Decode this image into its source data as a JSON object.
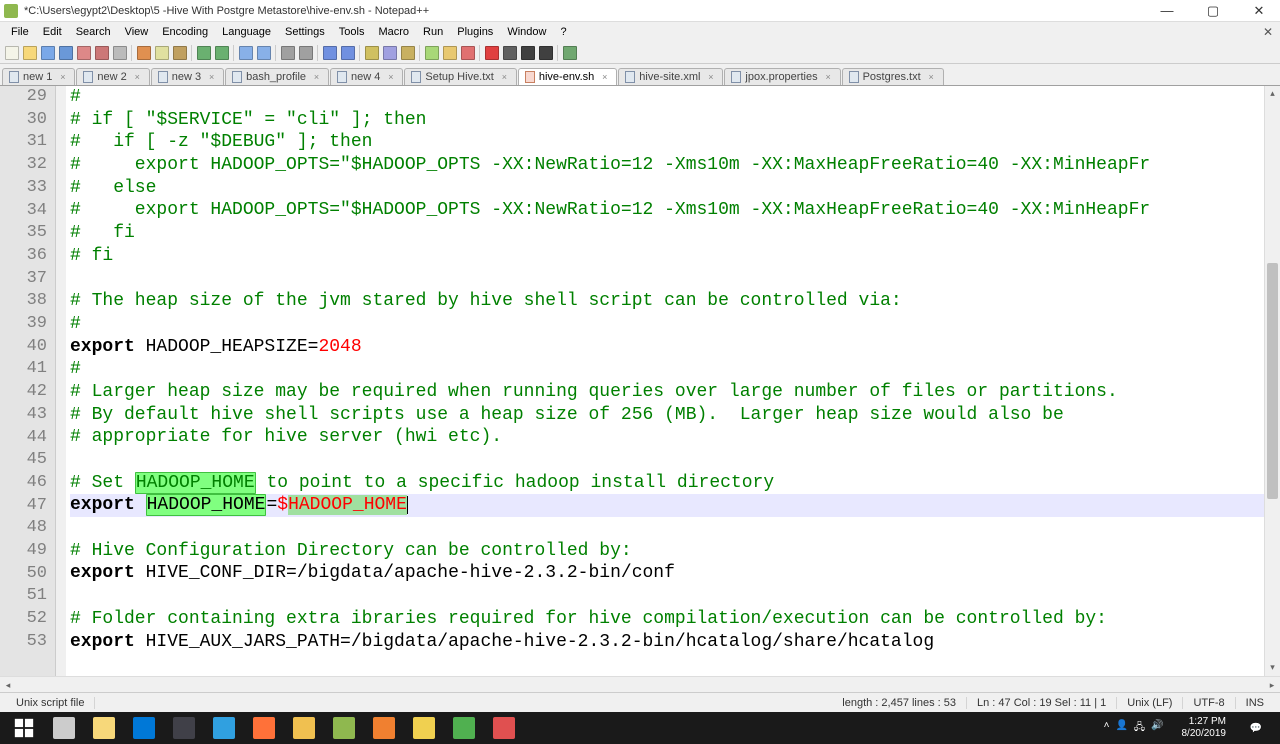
{
  "titlebar": {
    "title": "*C:\\Users\\egypt2\\Desktop\\5 -Hive With Postgre Metastore\\hive-env.sh - Notepad++"
  },
  "menubar": {
    "items": [
      "File",
      "Edit",
      "Search",
      "View",
      "Encoding",
      "Language",
      "Settings",
      "Tools",
      "Macro",
      "Run",
      "Plugins",
      "Window",
      "?"
    ]
  },
  "tabs": [
    {
      "label": "new 1",
      "dirty": false,
      "active": false
    },
    {
      "label": "new 2",
      "dirty": false,
      "active": false
    },
    {
      "label": "new 3",
      "dirty": false,
      "active": false
    },
    {
      "label": "bash_profile",
      "dirty": false,
      "active": false
    },
    {
      "label": "new 4",
      "dirty": false,
      "active": false
    },
    {
      "label": "Setup Hive.txt",
      "dirty": false,
      "active": false
    },
    {
      "label": "hive-env.sh",
      "dirty": true,
      "active": true
    },
    {
      "label": "hive-site.xml",
      "dirty": false,
      "active": false
    },
    {
      "label": "jpox.properties",
      "dirty": false,
      "active": false
    },
    {
      "label": "Postgres.txt",
      "dirty": false,
      "active": false
    }
  ],
  "editor": {
    "first_line": 29,
    "lines": [
      {
        "n": 29,
        "segs": [
          {
            "t": "#",
            "c": "comment"
          }
        ]
      },
      {
        "n": 30,
        "segs": [
          {
            "t": "# if [ \"$SERVICE\" = \"cli\" ]; then",
            "c": "comment"
          }
        ]
      },
      {
        "n": 31,
        "segs": [
          {
            "t": "#   if [ -z \"$DEBUG\" ]; then",
            "c": "comment"
          }
        ]
      },
      {
        "n": 32,
        "segs": [
          {
            "t": "#     export HADOOP_OPTS=\"$HADOOP_OPTS -XX:NewRatio=12 -Xms10m -XX:MaxHeapFreeRatio=40 -XX:MinHeapFr",
            "c": "comment"
          }
        ]
      },
      {
        "n": 33,
        "segs": [
          {
            "t": "#   else",
            "c": "comment"
          }
        ]
      },
      {
        "n": 34,
        "segs": [
          {
            "t": "#     export HADOOP_OPTS=\"$HADOOP_OPTS -XX:NewRatio=12 -Xms10m -XX:MaxHeapFreeRatio=40 -XX:MinHeapFr",
            "c": "comment"
          }
        ]
      },
      {
        "n": 35,
        "segs": [
          {
            "t": "#   fi",
            "c": "comment"
          }
        ]
      },
      {
        "n": 36,
        "segs": [
          {
            "t": "# fi",
            "c": "comment"
          }
        ]
      },
      {
        "n": 37,
        "segs": []
      },
      {
        "n": 38,
        "segs": [
          {
            "t": "# The heap size of the jvm stared by hive shell script can be controlled via:",
            "c": "comment"
          }
        ]
      },
      {
        "n": 39,
        "segs": [
          {
            "t": "#",
            "c": "comment"
          }
        ]
      },
      {
        "n": 40,
        "segs": [
          {
            "t": "export",
            "c": "keyword"
          },
          {
            "t": " HADOOP_HEAPSIZE=",
            "c": "text"
          },
          {
            "t": "2048",
            "c": "number"
          }
        ]
      },
      {
        "n": 41,
        "segs": [
          {
            "t": "#",
            "c": "comment"
          }
        ]
      },
      {
        "n": 42,
        "segs": [
          {
            "t": "# Larger heap size may be required when running queries over large number of files or partitions.",
            "c": "comment"
          }
        ]
      },
      {
        "n": 43,
        "segs": [
          {
            "t": "# By default hive shell scripts use a heap size of 256 (MB).  Larger heap size would also be",
            "c": "comment"
          }
        ]
      },
      {
        "n": 44,
        "segs": [
          {
            "t": "# appropriate for hive server (hwi etc).",
            "c": "comment"
          }
        ]
      },
      {
        "n": 45,
        "segs": []
      },
      {
        "n": 46,
        "segs": [
          {
            "t": "# Set ",
            "c": "comment"
          },
          {
            "t": "HADOOP_HOME",
            "c": "comment",
            "hl": "word"
          },
          {
            "t": " to point to a specific hadoop install directory",
            "c": "comment"
          }
        ]
      },
      {
        "n": 47,
        "current": true,
        "segs": [
          {
            "t": "export",
            "c": "keyword"
          },
          {
            "t": " ",
            "c": "text"
          },
          {
            "t": "HADOOP_HOME",
            "c": "text",
            "hl": "word"
          },
          {
            "t": "=",
            "c": "text"
          },
          {
            "t": "$",
            "c": "var"
          },
          {
            "t": "HADOOP_HOME",
            "c": "var",
            "hl": "sel"
          }
        ],
        "cursor_after": true
      },
      {
        "n": 48,
        "segs": []
      },
      {
        "n": 49,
        "segs": [
          {
            "t": "# Hive Configuration Directory can be controlled by:",
            "c": "comment"
          }
        ]
      },
      {
        "n": 50,
        "segs": [
          {
            "t": "export",
            "c": "keyword"
          },
          {
            "t": " HIVE_CONF_DIR=/bigdata/apache-hive-2.3.2-bin/conf",
            "c": "text"
          }
        ]
      },
      {
        "n": 51,
        "segs": []
      },
      {
        "n": 52,
        "segs": [
          {
            "t": "# Folder containing extra ibraries required for hive compilation/execution can be controlled by:",
            "c": "comment"
          }
        ]
      },
      {
        "n": 53,
        "segs": [
          {
            "t": "export",
            "c": "keyword"
          },
          {
            "t": " HIVE_AUX_JARS_PATH=/bigdata/apache-hive-2.3.2-bin/hcatalog/share/hcatalog",
            "c": "text"
          }
        ]
      }
    ]
  },
  "statusbar": {
    "file_type": "Unix script file",
    "length_label": "length : 2,457    lines : 53",
    "pos_label": "Ln : 47    Col : 19    Sel : 11 | 1",
    "eol": "Unix (LF)",
    "encoding": "UTF-8",
    "mode": "INS"
  },
  "taskbar": {
    "time": "1:27 PM",
    "date": "8/20/2019"
  },
  "toolbar_icons": [
    "new",
    "open",
    "save",
    "save-all",
    "close",
    "close-all",
    "print",
    "sep",
    "cut",
    "copy",
    "paste",
    "sep",
    "undo",
    "redo",
    "sep",
    "find",
    "replace",
    "sep",
    "zoom-in",
    "zoom-out",
    "sep",
    "sync-v",
    "sync-h",
    "sep",
    "wrap",
    "all-chars",
    "indent",
    "sep",
    "fold",
    "lang",
    "comment",
    "sep",
    "rec",
    "stop",
    "play",
    "play-multi",
    "sep",
    "monitor"
  ],
  "toolbar_colors": {
    "new": "#f4f4e8",
    "open": "#f7d87a",
    "save": "#7aa8e8",
    "save-all": "#6a98d8",
    "close": "#d88",
    "close-all": "#c77",
    "print": "#bbb",
    "cut": "#e09050",
    "copy": "#e0e0a0",
    "paste": "#c0a060",
    "undo": "#6ab070",
    "redo": "#6ab070",
    "find": "#88b0e8",
    "replace": "#88b0e8",
    "zoom-in": "#a0a0a0",
    "zoom-out": "#a0a0a0",
    "sync-v": "#7090e0",
    "sync-h": "#7090e0",
    "wrap": "#d0c060",
    "all-chars": "#a0a0e0",
    "indent": "#c8b060",
    "fold": "#a8d878",
    "lang": "#e8c870",
    "comment": "#e07070",
    "rec": "#e04040",
    "stop": "#606060",
    "play": "#404040",
    "play-multi": "#404040",
    "monitor": "#70a870"
  },
  "task_icons": [
    {
      "name": "start",
      "color": "#ffffff"
    },
    {
      "name": "task-view",
      "color": "#cccccc"
    },
    {
      "name": "file-explorer",
      "color": "#f7d87a"
    },
    {
      "name": "edge",
      "color": "#0078d7"
    },
    {
      "name": "photos",
      "color": "#404048"
    },
    {
      "name": "store",
      "color": "#30a0e0"
    },
    {
      "name": "firefox",
      "color": "#ff7139"
    },
    {
      "name": "chrome",
      "color": "#f0c050"
    },
    {
      "name": "notepadpp",
      "color": "#8fb84f"
    },
    {
      "name": "app-orange",
      "color": "#f08030"
    },
    {
      "name": "app-yellow",
      "color": "#f0d050"
    },
    {
      "name": "app-green",
      "color": "#50b050"
    },
    {
      "name": "app-red",
      "color": "#e05050"
    }
  ]
}
